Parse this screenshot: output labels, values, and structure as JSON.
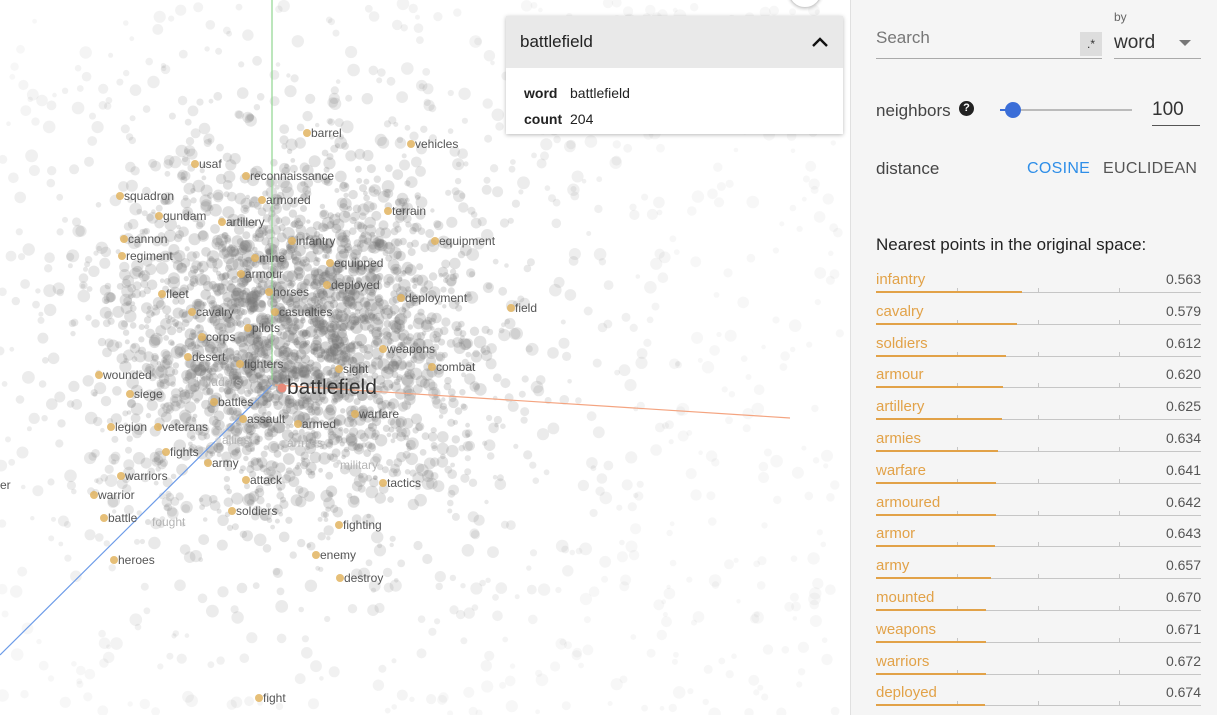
{
  "projection": {
    "focus_word": "battlefield",
    "labels": [
      {
        "text": "barrel",
        "dim": false
      },
      {
        "text": "vehicles",
        "dim": false
      },
      {
        "text": "usaf",
        "dim": false
      },
      {
        "text": "reconnaissance",
        "dim": false
      },
      {
        "text": "squadron",
        "dim": false
      },
      {
        "text": "armored",
        "dim": false
      },
      {
        "text": "gundam",
        "dim": false
      },
      {
        "text": "artillery",
        "dim": false
      },
      {
        "text": "terrain",
        "dim": false
      },
      {
        "text": "cannon",
        "dim": false
      },
      {
        "text": "infantry",
        "dim": false
      },
      {
        "text": "equipment",
        "dim": false
      },
      {
        "text": "regiment",
        "dim": false
      },
      {
        "text": "mine",
        "dim": false
      },
      {
        "text": "equipped",
        "dim": false
      },
      {
        "text": "armour",
        "dim": false
      },
      {
        "text": "deployed",
        "dim": false
      },
      {
        "text": "fleet",
        "dim": false
      },
      {
        "text": "horses",
        "dim": false
      },
      {
        "text": "deployment",
        "dim": false
      },
      {
        "text": "casualties",
        "dim": false
      },
      {
        "text": "field",
        "dim": false
      },
      {
        "text": "cavalry",
        "dim": false
      },
      {
        "text": "pilots",
        "dim": false
      },
      {
        "text": "corps",
        "dim": false
      },
      {
        "text": "weapons",
        "dim": false
      },
      {
        "text": "desert",
        "dim": false
      },
      {
        "text": "fighters",
        "dim": false
      },
      {
        "text": "sight",
        "dim": false
      },
      {
        "text": "combat",
        "dim": false
      },
      {
        "text": "wounded",
        "dim": false
      },
      {
        "text": "invaders",
        "dim": true
      },
      {
        "text": "siege",
        "dim": false
      },
      {
        "text": "battles",
        "dim": false
      },
      {
        "text": "warfare",
        "dim": false
      },
      {
        "text": "legion",
        "dim": false
      },
      {
        "text": "veterans",
        "dim": false
      },
      {
        "text": "assault",
        "dim": false
      },
      {
        "text": "armed",
        "dim": false
      },
      {
        "text": "allies",
        "dim": true
      },
      {
        "text": "armies",
        "dim": true
      },
      {
        "text": "fights",
        "dim": false
      },
      {
        "text": "army",
        "dim": false
      },
      {
        "text": "military",
        "dim": true
      },
      {
        "text": "warriors",
        "dim": false
      },
      {
        "text": "attack",
        "dim": false
      },
      {
        "text": "tactics",
        "dim": false
      },
      {
        "text": "warrior",
        "dim": false
      },
      {
        "text": "er",
        "dim": false
      },
      {
        "text": "soldiers",
        "dim": false
      },
      {
        "text": "battle",
        "dim": false
      },
      {
        "text": "fought",
        "dim": true
      },
      {
        "text": "fighting",
        "dim": false
      },
      {
        "text": "enemy",
        "dim": false
      },
      {
        "text": "heroes",
        "dim": false
      },
      {
        "text": "destroy",
        "dim": false
      },
      {
        "text": "fight",
        "dim": false
      }
    ]
  },
  "info_card": {
    "title": "battlefield",
    "word_label": "word",
    "word_value": "battlefield",
    "count_label": "count",
    "count_value": "204"
  },
  "panel": {
    "search_placeholder": "Search",
    "regex_label": ".*",
    "by_label": "by",
    "by_value": "word",
    "neighbors_label": "neighbors",
    "neighbors_help": "?",
    "neighbors_value": "100",
    "neighbors_slider_fraction": 0.1,
    "distance_label": "distance",
    "distance_cosine": "COSINE",
    "distance_euclidean": "EUCLIDEAN",
    "nearest_title": "Nearest points in the original space:",
    "accent_color": "#e2a248",
    "active_color": "#2e8ee8",
    "neighbors": [
      {
        "word": "infantry",
        "value": "0.563"
      },
      {
        "word": "cavalry",
        "value": "0.579"
      },
      {
        "word": "soldiers",
        "value": "0.612"
      },
      {
        "word": "armour",
        "value": "0.620"
      },
      {
        "word": "artillery",
        "value": "0.625"
      },
      {
        "word": "armies",
        "value": "0.634"
      },
      {
        "word": "warfare",
        "value": "0.641"
      },
      {
        "word": "armoured",
        "value": "0.642"
      },
      {
        "word": "armor",
        "value": "0.643"
      },
      {
        "word": "army",
        "value": "0.657"
      },
      {
        "word": "mounted",
        "value": "0.670"
      },
      {
        "word": "weapons",
        "value": "0.671"
      },
      {
        "word": "warriors",
        "value": "0.672"
      },
      {
        "word": "deployed",
        "value": "0.674"
      }
    ]
  }
}
